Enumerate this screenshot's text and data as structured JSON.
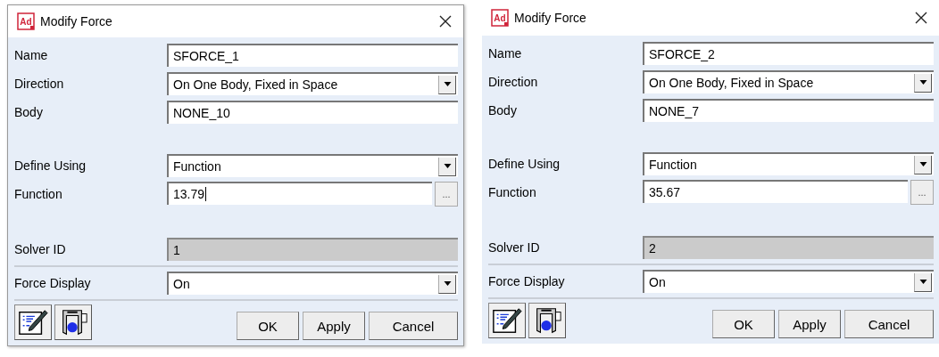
{
  "dialogs": [
    {
      "logo": "Ad",
      "title": "Modify Force",
      "sections": [
        [
          {
            "label": "Name",
            "kind": "text",
            "value": "SFORCE_1"
          },
          {
            "label": "Direction",
            "kind": "select",
            "value": "On One Body, Fixed in Space"
          },
          {
            "label": "Body",
            "kind": "text",
            "value": "NONE_10"
          }
        ],
        [
          {
            "label": "Define Using",
            "kind": "select",
            "value": "Function"
          },
          {
            "label": "Function",
            "kind": "function",
            "value": "13.79",
            "focused": true,
            "button": "..."
          }
        ],
        [
          {
            "label": "Solver ID",
            "kind": "readonly",
            "value": "1"
          }
        ],
        [
          {
            "label": "Force Display",
            "kind": "select",
            "value": "On"
          }
        ]
      ],
      "buttons": [
        "OK",
        "Apply",
        "Cancel"
      ]
    },
    {
      "logo": "Ad",
      "title": "Modify Force",
      "sections": [
        [
          {
            "label": "Name",
            "kind": "text",
            "value": "SFORCE_2"
          },
          {
            "label": "Direction",
            "kind": "select",
            "value": "On One Body, Fixed in Space"
          },
          {
            "label": "Body",
            "kind": "text",
            "value": "NONE_7"
          }
        ],
        [
          {
            "label": "Define Using",
            "kind": "select",
            "value": "Function"
          },
          {
            "label": "Function",
            "kind": "function",
            "value": "35.67",
            "focused": false,
            "button": "..."
          }
        ],
        [
          {
            "label": "Solver ID",
            "kind": "readonly",
            "value": "2"
          }
        ],
        [
          {
            "label": "Force Display",
            "kind": "select",
            "value": "On"
          }
        ]
      ],
      "buttons": [
        "OK",
        "Apply",
        "Cancel"
      ]
    }
  ]
}
